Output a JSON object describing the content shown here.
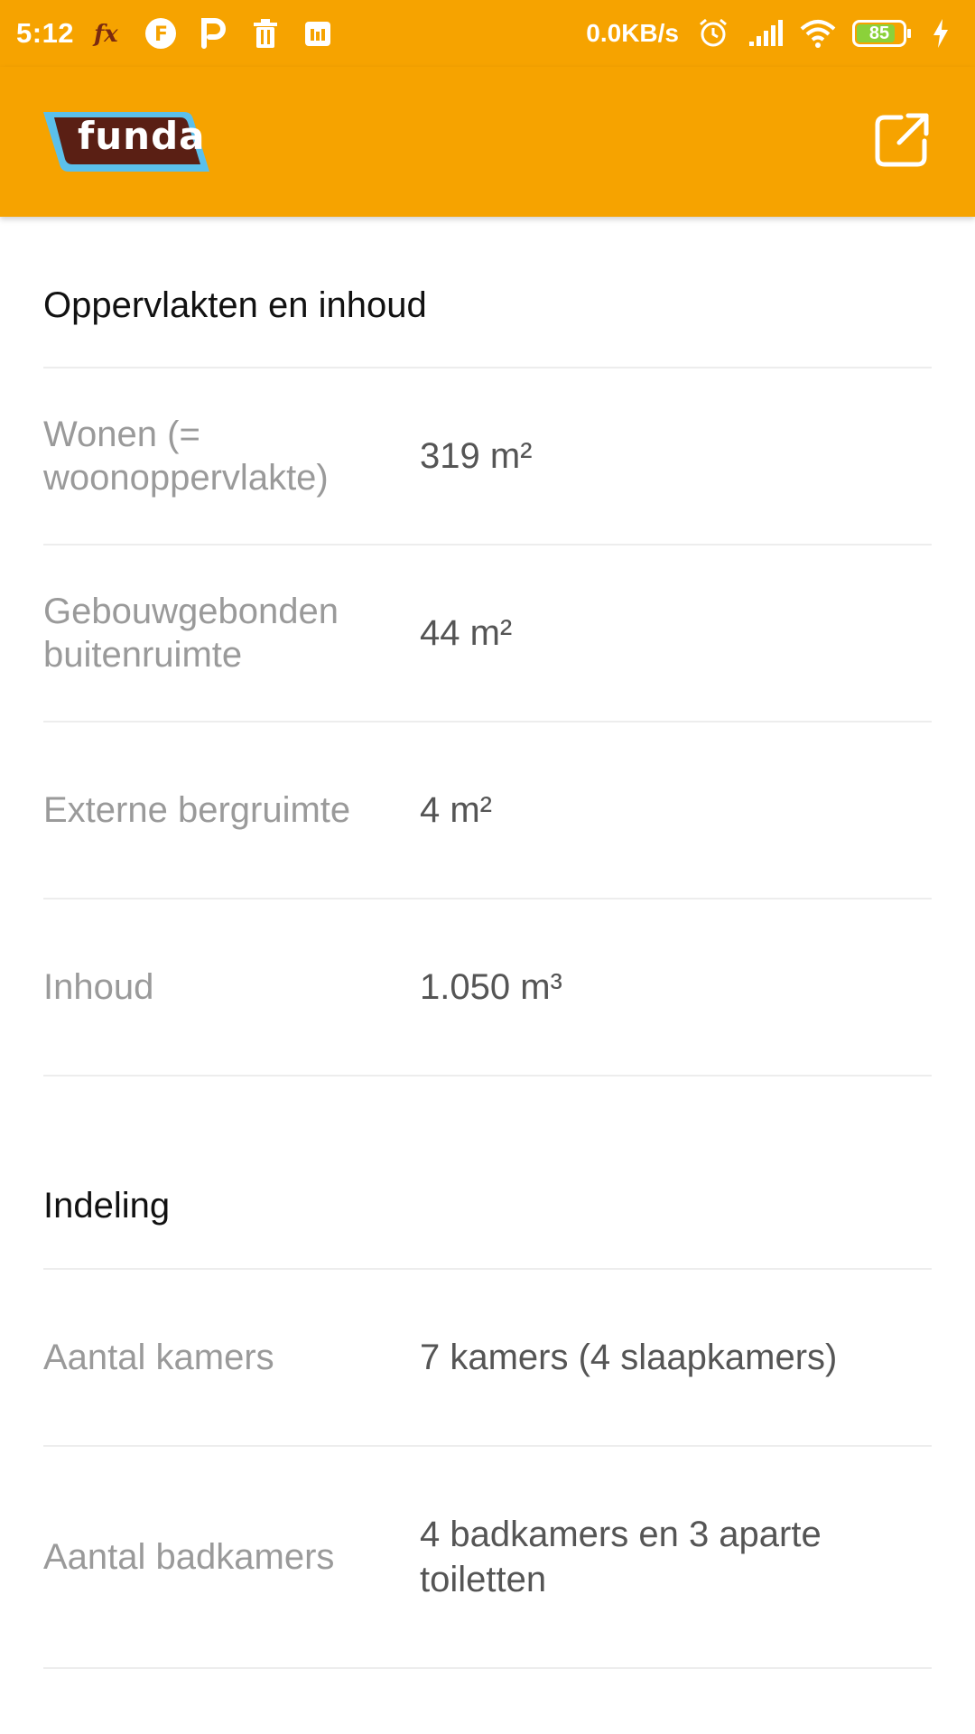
{
  "status_bar": {
    "time": "5:12",
    "network_speed": "0.0KB/s",
    "battery_percent": "85",
    "icons": [
      "fx-icon",
      "f-circle-icon",
      "p-icon",
      "trash-icon",
      "calendar-icon",
      "alarm-icon",
      "signal-icon",
      "wifi-icon",
      "battery-icon",
      "charging-icon"
    ]
  },
  "app_bar": {
    "logo_text": "funda",
    "colors": {
      "background": "#f6a300",
      "logo_fill": "#5a1f14",
      "logo_border": "#5bc0eb"
    },
    "action_icon": "open-in-new-icon"
  },
  "sections": [
    {
      "title": "Oppervlakten en inhoud",
      "rows": [
        {
          "label": "Wonen (= woonoppervlakte)",
          "value": "319 m²"
        },
        {
          "label": "Gebouwgebonden buitenruimte",
          "value": "44 m²"
        },
        {
          "label": "Externe bergruimte",
          "value": "4 m²"
        },
        {
          "label": "Inhoud",
          "value": "1.050 m³"
        }
      ]
    },
    {
      "title": "Indeling",
      "rows": [
        {
          "label": "Aantal kamers",
          "value": "7 kamers (4 slaapkamers)"
        },
        {
          "label": "Aantal badkamers",
          "value": "4 badkamers en 3 aparte toiletten"
        }
      ]
    }
  ]
}
